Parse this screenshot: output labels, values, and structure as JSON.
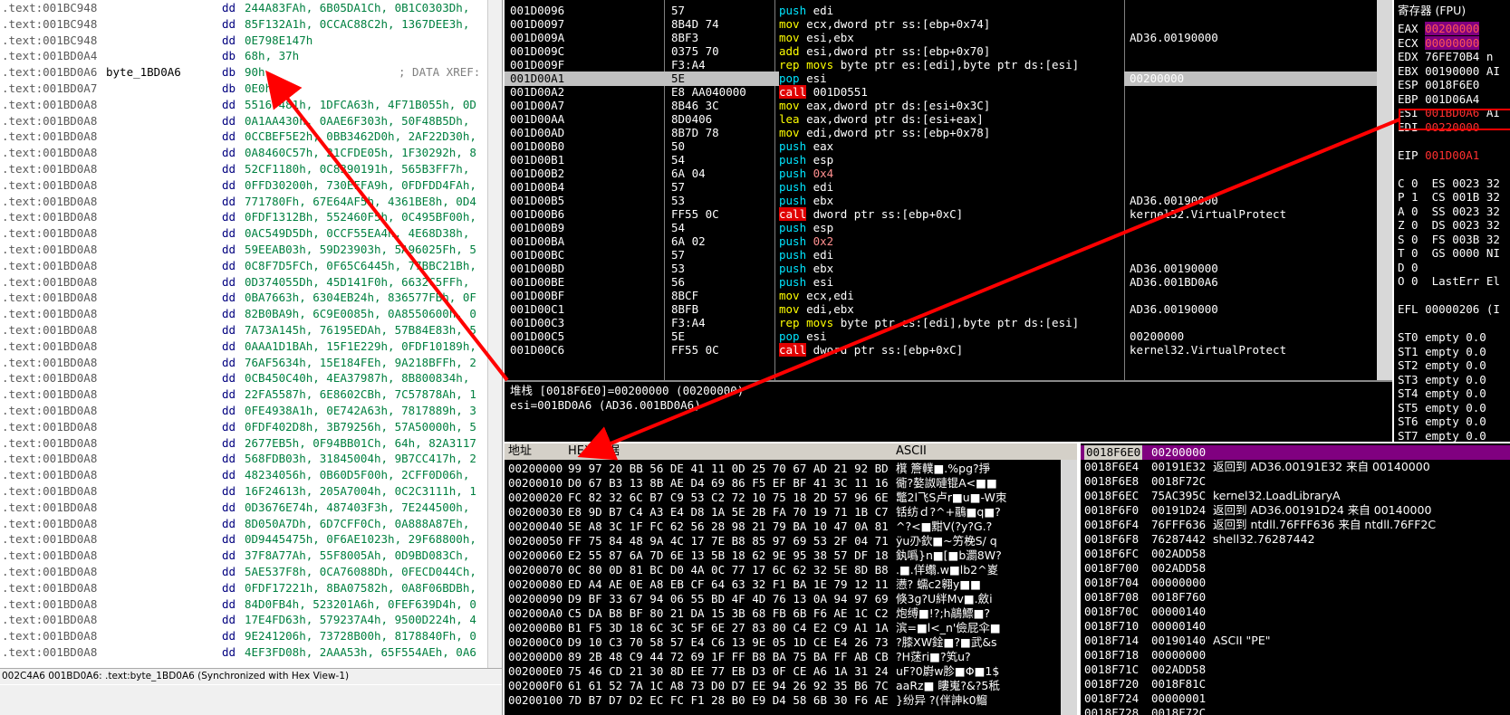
{
  "ida": {
    "lines": [
      {
        "addr": ".text:001BC948",
        "name": "",
        "op": "dd",
        "val": "244A83FAh, 6B05DA1Ch, 0B1C0303Dh,",
        "cmt": ""
      },
      {
        "addr": ".text:001BC948",
        "name": "",
        "op": "dd",
        "val": "85F132A1h, 0CCAC88C2h, 1367DEE3h,",
        "cmt": ""
      },
      {
        "addr": ".text:001BC948",
        "name": "",
        "op": "dd",
        "val": "0E798E147h",
        "cmt": ""
      },
      {
        "addr": ".text:001BD0A4",
        "name": "",
        "op": "db",
        "val": "68h, 37h",
        "cmt": ""
      },
      {
        "addr": ".text:001BD0A6",
        "name": "byte_1BD0A6",
        "op": "db",
        "val": "90h",
        "cmt": "; DATA XREF:"
      },
      {
        "addr": ".text:001BD0A7",
        "name": "",
        "op": "db",
        "val": "0E0h",
        "cmt": ""
      },
      {
        "addr": ".text:001BD0A8",
        "name": "",
        "op": "dd",
        "val": "55167481h, 1DFCA63h, 4F71B055h, 0D",
        "cmt": ""
      },
      {
        "addr": ".text:001BD0A8",
        "name": "",
        "op": "dd",
        "val": "0A1AA430h, 0AAE6F303h, 50F48B5Dh,",
        "cmt": ""
      },
      {
        "addr": ".text:001BD0A8",
        "name": "",
        "op": "dd",
        "val": "0CCBEF5E2h, 0BB3462D0h, 2AF22D30h,",
        "cmt": ""
      },
      {
        "addr": ".text:001BD0A8",
        "name": "",
        "op": "dd",
        "val": "0A8460C57h, 21CFDE05h, 1F30292h, 8",
        "cmt": ""
      },
      {
        "addr": ".text:001BD0A8",
        "name": "",
        "op": "dd",
        "val": "52CF1180h, 0C8390191h, 565B3FF7h,",
        "cmt": ""
      },
      {
        "addr": ".text:001BD0A8",
        "name": "",
        "op": "dd",
        "val": "0FFD30200h, 730EFFA9h, 0FDFDD4FAh,",
        "cmt": ""
      },
      {
        "addr": ".text:001BD0A8",
        "name": "",
        "op": "dd",
        "val": "771780Fh, 67E64AF5h, 4361BE8h, 0D4",
        "cmt": ""
      },
      {
        "addr": ".text:001BD0A8",
        "name": "",
        "op": "dd",
        "val": "0FDF1312Bh, 552460F5h, 0C495BF00h,",
        "cmt": ""
      },
      {
        "addr": ".text:001BD0A8",
        "name": "",
        "op": "dd",
        "val": "0AC549D5Dh, 0CCF55EA4h, 4E68D38h,",
        "cmt": ""
      },
      {
        "addr": ".text:001BD0A8",
        "name": "",
        "op": "dd",
        "val": "59EEAB03h, 59D23903h, 5A96025Fh, 5",
        "cmt": ""
      },
      {
        "addr": ".text:001BD0A8",
        "name": "",
        "op": "dd",
        "val": "0C8F7D5FCh, 0F65C6445h, 77BBC21Bh,",
        "cmt": ""
      },
      {
        "addr": ".text:001BD0A8",
        "name": "",
        "op": "dd",
        "val": "0D374055Dh, 45D141F0h, 6632C5FFh,",
        "cmt": ""
      },
      {
        "addr": ".text:001BD0A8",
        "name": "",
        "op": "dd",
        "val": "0BA7663h, 6304EB24h, 836577FBh, 0F",
        "cmt": ""
      },
      {
        "addr": ".text:001BD0A8",
        "name": "",
        "op": "dd",
        "val": "82B0BA9h, 6C9E0085h, 0A8550600h, 0",
        "cmt": ""
      },
      {
        "addr": ".text:001BD0A8",
        "name": "",
        "op": "dd",
        "val": "7A73A145h, 76195EDAh, 57B84E83h, 5",
        "cmt": ""
      },
      {
        "addr": ".text:001BD0A8",
        "name": "",
        "op": "dd",
        "val": "0AAA1D1BAh, 15F1E229h, 0FDF10189h,",
        "cmt": ""
      },
      {
        "addr": ".text:001BD0A8",
        "name": "",
        "op": "dd",
        "val": "76AF5634h, 15E184FEh, 9A218BFFh, 2",
        "cmt": ""
      },
      {
        "addr": ".text:001BD0A8",
        "name": "",
        "op": "dd",
        "val": "0CB450C40h, 4EA37987h, 8B800834h,",
        "cmt": ""
      },
      {
        "addr": ".text:001BD0A8",
        "name": "",
        "op": "dd",
        "val": "22FA5587h, 6E8602CBh, 7C57878Ah, 1",
        "cmt": ""
      },
      {
        "addr": ".text:001BD0A8",
        "name": "",
        "op": "dd",
        "val": "0FE4938A1h, 0E742A63h, 7817889h, 3",
        "cmt": ""
      },
      {
        "addr": ".text:001BD0A8",
        "name": "",
        "op": "dd",
        "val": "0FDF402D8h, 3B79256h, 57A50000h, 5",
        "cmt": ""
      },
      {
        "addr": ".text:001BD0A8",
        "name": "",
        "op": "dd",
        "val": "2677EB5h, 0F94BB01Ch, 64h, 82A3117",
        "cmt": ""
      },
      {
        "addr": ".text:001BD0A8",
        "name": "",
        "op": "dd",
        "val": "568FDB03h, 31845004h, 9B7CC417h, 2",
        "cmt": ""
      },
      {
        "addr": ".text:001BD0A8",
        "name": "",
        "op": "dd",
        "val": "48234056h, 0B60D5F00h, 2CFF0D06h,",
        "cmt": ""
      },
      {
        "addr": ".text:001BD0A8",
        "name": "",
        "op": "dd",
        "val": "16F24613h, 205A7004h, 0C2C3111h, 1",
        "cmt": ""
      },
      {
        "addr": ".text:001BD0A8",
        "name": "",
        "op": "dd",
        "val": "0D3676E74h, 487403F3h, 7E244500h,",
        "cmt": ""
      },
      {
        "addr": ".text:001BD0A8",
        "name": "",
        "op": "dd",
        "val": "8D050A7Dh, 6D7CFF0Ch, 0A888A87Eh,",
        "cmt": ""
      },
      {
        "addr": ".text:001BD0A8",
        "name": "",
        "op": "dd",
        "val": "0D9445475h, 0F6AE1023h, 29F68800h,",
        "cmt": ""
      },
      {
        "addr": ".text:001BD0A8",
        "name": "",
        "op": "dd",
        "val": "37F8A77Ah, 55F8005Ah, 0D9BD083Ch,",
        "cmt": ""
      },
      {
        "addr": ".text:001BD0A8",
        "name": "",
        "op": "dd",
        "val": "5AE537F8h, 0CA76088Dh, 0FECD044Ch,",
        "cmt": ""
      },
      {
        "addr": ".text:001BD0A8",
        "name": "",
        "op": "dd",
        "val": "0FDF17221h, 8BA07582h, 0A8F06BDBh,",
        "cmt": ""
      },
      {
        "addr": ".text:001BD0A8",
        "name": "",
        "op": "dd",
        "val": "84D0FB4h, 523201A6h, 0FEF639D4h, 0",
        "cmt": ""
      },
      {
        "addr": ".text:001BD0A8",
        "name": "",
        "op": "dd",
        "val": "17E4FD63h, 579237A4h, 9500D224h, 4",
        "cmt": ""
      },
      {
        "addr": ".text:001BD0A8",
        "name": "",
        "op": "dd",
        "val": "9E241206h, 73728B00h, 8178840Fh, 0",
        "cmt": ""
      },
      {
        "addr": ".text:001BD0A8",
        "name": "",
        "op": "dd",
        "val": "4EF3FD08h, 2AAA53h, 65F554AEh, 0A6",
        "cmt": ""
      }
    ],
    "status": "002C4A6 001BD0A6: .text:byte_1BD0A6 (Synchronized with Hex View-1)"
  },
  "cpu": {
    "rows": [
      {
        "addr": "001D0096",
        "hex": "57",
        "asm": [
          [
            "push",
            "push"
          ],
          [
            " edi",
            ""
          ]
        ],
        "cmt": ""
      },
      {
        "addr": "001D0097",
        "hex": "8B4D 74",
        "asm": [
          [
            "mov",
            "mov"
          ],
          [
            " ecx,dword ptr ss:[ebp+0x74]",
            ""
          ]
        ],
        "cmt": ""
      },
      {
        "addr": "001D009A",
        "hex": "8BF3",
        "asm": [
          [
            "mov",
            "mov"
          ],
          [
            " esi,ebx",
            ""
          ]
        ],
        "cmt": "AD36.00190000"
      },
      {
        "addr": "001D009C",
        "hex": "0375 70",
        "asm": [
          [
            "add",
            "mov"
          ],
          [
            " esi,dword ptr ss:[ebp+0x70]",
            ""
          ]
        ],
        "cmt": ""
      },
      {
        "addr": "001D009F",
        "hex": "F3:A4",
        "asm": [
          [
            "rep movs",
            "mov"
          ],
          [
            " byte ptr es:[edi],byte ptr ds:[esi]",
            ""
          ]
        ],
        "cmt": ""
      },
      {
        "addr": "001D00A1",
        "hex": "5E",
        "asm": [
          [
            "pop",
            "pop"
          ],
          [
            " esi",
            ""
          ]
        ],
        "cmt": "00200000",
        "sel": true
      },
      {
        "addr": "001D00A2",
        "hex": "E8 AA040000",
        "asm": [
          [
            "call",
            "call"
          ],
          [
            " 001D0551",
            ""
          ]
        ],
        "cmt": ""
      },
      {
        "addr": "001D00A7",
        "hex": "8B46 3C",
        "asm": [
          [
            "mov",
            "mov"
          ],
          [
            " eax,dword ptr ds:[esi+0x3C]",
            ""
          ]
        ],
        "cmt": ""
      },
      {
        "addr": "001D00AA",
        "hex": "8D0406",
        "asm": [
          [
            "lea",
            "mov"
          ],
          [
            " eax,dword ptr ds:[esi+eax]",
            ""
          ]
        ],
        "cmt": ""
      },
      {
        "addr": "001D00AD",
        "hex": "8B7D 78",
        "asm": [
          [
            "mov",
            "mov"
          ],
          [
            " edi,dword ptr ss:[ebp+0x78]",
            ""
          ]
        ],
        "cmt": ""
      },
      {
        "addr": "001D00B0",
        "hex": "50",
        "asm": [
          [
            "push",
            "push"
          ],
          [
            " eax",
            ""
          ]
        ],
        "cmt": ""
      },
      {
        "addr": "001D00B1",
        "hex": "54",
        "asm": [
          [
            "push",
            "push"
          ],
          [
            " esp",
            ""
          ]
        ],
        "cmt": ""
      },
      {
        "addr": "001D00B2",
        "hex": "6A 04",
        "asm": [
          [
            "push",
            "push"
          ],
          [
            " 0x4",
            "num"
          ]
        ],
        "cmt": ""
      },
      {
        "addr": "001D00B4",
        "hex": "57",
        "asm": [
          [
            "push",
            "push"
          ],
          [
            " edi",
            ""
          ]
        ],
        "cmt": ""
      },
      {
        "addr": "001D00B5",
        "hex": "53",
        "asm": [
          [
            "push",
            "push"
          ],
          [
            " ebx",
            ""
          ]
        ],
        "cmt": "AD36.00190000"
      },
      {
        "addr": "001D00B6",
        "hex": "FF55 0C",
        "asm": [
          [
            "call",
            "call"
          ],
          [
            " dword ptr ss:[ebp+0xC]",
            ""
          ]
        ],
        "cmt": "kernel32.VirtualProtect"
      },
      {
        "addr": "001D00B9",
        "hex": "54",
        "asm": [
          [
            "push",
            "push"
          ],
          [
            " esp",
            ""
          ]
        ],
        "cmt": ""
      },
      {
        "addr": "001D00BA",
        "hex": "6A 02",
        "asm": [
          [
            "push",
            "push"
          ],
          [
            " 0x2",
            "num"
          ]
        ],
        "cmt": ""
      },
      {
        "addr": "001D00BC",
        "hex": "57",
        "asm": [
          [
            "push",
            "push"
          ],
          [
            " edi",
            ""
          ]
        ],
        "cmt": ""
      },
      {
        "addr": "001D00BD",
        "hex": "53",
        "asm": [
          [
            "push",
            "push"
          ],
          [
            " ebx",
            ""
          ]
        ],
        "cmt": "AD36.00190000"
      },
      {
        "addr": "001D00BE",
        "hex": "56",
        "asm": [
          [
            "push",
            "push"
          ],
          [
            " esi",
            ""
          ]
        ],
        "cmt": "AD36.001BD0A6"
      },
      {
        "addr": "001D00BF",
        "hex": "8BCF",
        "asm": [
          [
            "mov",
            "mov"
          ],
          [
            " ecx,edi",
            ""
          ]
        ],
        "cmt": ""
      },
      {
        "addr": "001D00C1",
        "hex": "8BFB",
        "asm": [
          [
            "mov",
            "mov"
          ],
          [
            " edi,ebx",
            ""
          ]
        ],
        "cmt": "AD36.00190000"
      },
      {
        "addr": "001D00C3",
        "hex": "F3:A4",
        "asm": [
          [
            "rep movs",
            "mov"
          ],
          [
            " byte ptr es:[edi],byte ptr ds:[esi]",
            ""
          ]
        ],
        "cmt": ""
      },
      {
        "addr": "001D00C5",
        "hex": "5E",
        "asm": [
          [
            "pop",
            "pop"
          ],
          [
            " esi",
            ""
          ]
        ],
        "cmt": "00200000"
      },
      {
        "addr": "001D00C6",
        "hex": "FF55 0C",
        "asm": [
          [
            "call",
            "call"
          ],
          [
            " dword ptr ss:[ebp+0xC]",
            ""
          ]
        ],
        "cmt": "kernel32.VirtualProtect"
      }
    ],
    "info1": "堆栈 [0018F6E0]=00200000 (00200000)",
    "info2": "esi=001BD0A6 (AD36.001BD0A6)"
  },
  "regs": {
    "title": "寄存器 (FPU)",
    "rows": [
      {
        "t": "EAX 00200000",
        "hl": "EAX"
      },
      {
        "t": "ECX 00000000",
        "hl": "ECX"
      },
      {
        "t": "EDX 76FE70B4 n"
      },
      {
        "t": "EBX 00190000 AI"
      },
      {
        "t": "ESP 0018F6E0"
      },
      {
        "t": "EBP 001D06A4"
      },
      {
        "t": "ESI 001BD0A6 AI",
        "hl": "ESI"
      },
      {
        "t": "EDI 00220000",
        "hl": "EDI"
      },
      {
        "t": ""
      },
      {
        "t": "EIP 001D00A1",
        "hl": "EIP"
      },
      {
        "t": ""
      },
      {
        "t": "C 0  ES 0023 32"
      },
      {
        "t": "P 1  CS 001B 32"
      },
      {
        "t": "A 0  SS 0023 32"
      },
      {
        "t": "Z 0  DS 0023 32"
      },
      {
        "t": "S 0  FS 003B 32"
      },
      {
        "t": "T 0  GS 0000 NI"
      },
      {
        "t": "D 0"
      },
      {
        "t": "O 0  LastErr El"
      },
      {
        "t": ""
      },
      {
        "t": "EFL 00000206 (I"
      },
      {
        "t": ""
      },
      {
        "t": "ST0 empty 0.0"
      },
      {
        "t": "ST1 empty 0.0"
      },
      {
        "t": "ST2 empty 0.0"
      },
      {
        "t": "ST3 empty 0.0"
      },
      {
        "t": "ST4 empty 0.0"
      },
      {
        "t": "ST5 empty 0.0"
      },
      {
        "t": "ST6 empty 0.0"
      },
      {
        "t": "ST7 empty 0.0"
      }
    ]
  },
  "dump": {
    "head_addr": "地址",
    "head_hex": "HEX 数据",
    "head_ascii": "ASCII",
    "rows": [
      {
        "a": "00200000",
        "h": "99 97 20 BB 56 DE 41 11 0D 25 70 67 AD 21 92 BD",
        "s": "檱 簷轐■.%pg?掙"
      },
      {
        "a": "00200010",
        "h": "D0 67 B3 13 8B AE D4 69 86 F5 EF BF 41 3C 11 16",
        "s": "衚?嫯詉嗹锟A<■■"
      },
      {
        "a": "00200020",
        "h": "FC 82 32 6C B7 C9 53 C2 72 10 75 18 2D 57 96 6E",
        "s": "鼈2l飞S卢r■u■-W朿"
      },
      {
        "a": "00200030",
        "h": "E8 9D B7 C4 A3 E4 D8 1A 5E 2B FA 70 19 71 1B C7",
        "s": "铦纺ｄ?^+鷊■q■?"
      },
      {
        "a": "00200040",
        "h": "5E A8 3C 1F FC 62 56 28 98 21 79 BA 10 47 0A 81",
        "s": "^?<■黚V(?y?G.?"
      },
      {
        "a": "00200050",
        "h": "FF 75 84 48 9A 4C 17 7E B8 85 97 69 53 2F 04 71",
        "s": "ÿu刅欽■~竻梚S/ q"
      },
      {
        "a": "00200060",
        "h": "E2 55 87 6A 7D 6E 13 5B 18 62 9E 95 38 57 DF 18",
        "s": "釻噅}n■[■b瀱8W?"
      },
      {
        "a": "00200070",
        "h": "0C 80 0D 81 BC D0 4A 0C 77 17 6C 62 32 5E 8D B8",
        "s": ".■.佯蠮.w■lb2^嵏"
      },
      {
        "a": "00200080",
        "h": "ED A4 AE 0E A8 EB CF 64 63 32 F1 BA 1E 79 12 11",
        "s": "懑? 蠕c2翱y■■"
      },
      {
        "a": "00200090",
        "h": "D9 BF 33 67 94 06 55 BD 4F 4D 76 13 0A 94 97 69",
        "s": "倏3g?U絆Mv■.斂i"
      },
      {
        "a": "002000A0",
        "h": "C5 DA B8 BF 80 21 DA 15 3B 68 FB 6B F6 AE 1C C2",
        "s": "炮缚■!?;h鶮鰾■?"
      },
      {
        "a": "002000B0",
        "h": "B1 F5 3D 18 6C 3C 5F 6E 27 83 80 C4 E2 C9 A1 1A",
        "s": "滨=■l<_n'儉屁伞■"
      },
      {
        "a": "002000C0",
        "h": "D9 10 C3 70 58 57 E4 C6 13 9E 05 1D CE E4 26 73",
        "s": "?膝XW鍂■?■武&s"
      },
      {
        "a": "002000D0",
        "h": "89 2B 48 C9 44 72 69 1F FF B8 BA 75 BA FF AB CB",
        "s": "?H蒁ri■?笂u?"
      },
      {
        "a": "002000E0",
        "h": "75 46 CD 21 30 8D EE 77 EB D3 0F CE A6 1A 31 24",
        "s": "uF?0嶎w胗■Φ■1$"
      },
      {
        "a": "002000F0",
        "h": "61 61 52 7A 1C A8 73 D0 D7 EE 94 26 92 35 B6 7C",
        "s": "aaRz■ 瞜嵬?&?5秪"
      },
      {
        "a": "00200100",
        "h": "7D B7 D7 D2 EC FC F1 28 B0 E9 D4 58 6B 30 F6 AE",
        "s": "}纷异 ?(伴訷k0鰡"
      }
    ]
  },
  "stack": {
    "rows": [
      {
        "a": "0018F6E0",
        "v": "00200000",
        "c": "",
        "sel": true
      },
      {
        "a": "0018F6E4",
        "v": "00191E32",
        "c": "返回到 AD36.00191E32 来自 00140000"
      },
      {
        "a": "0018F6E8",
        "v": "0018F72C",
        "c": ""
      },
      {
        "a": "0018F6EC",
        "v": "75AC395C",
        "c": "kernel32.LoadLibraryA"
      },
      {
        "a": "0018F6F0",
        "v": "00191D24",
        "c": "返回到 AD36.00191D24 来自 00140000"
      },
      {
        "a": "0018F6F4",
        "v": "76FFF636",
        "c": "返回到 ntdll.76FFF636 来自 ntdll.76FF2C"
      },
      {
        "a": "0018F6F8",
        "v": "76287442",
        "c": "shell32.76287442"
      },
      {
        "a": "0018F6FC",
        "v": "002ADD58",
        "c": ""
      },
      {
        "a": "0018F700",
        "v": "002ADD58",
        "c": ""
      },
      {
        "a": "0018F704",
        "v": "00000000",
        "c": ""
      },
      {
        "a": "0018F708",
        "v": "0018F760",
        "c": ""
      },
      {
        "a": "0018F70C",
        "v": "00000140",
        "c": ""
      },
      {
        "a": "0018F710",
        "v": "00000140",
        "c": ""
      },
      {
        "a": "0018F714",
        "v": "00190140",
        "c": "ASCII \"PE\""
      },
      {
        "a": "0018F718",
        "v": "00000000",
        "c": ""
      },
      {
        "a": "0018F71C",
        "v": "002ADD58",
        "c": ""
      },
      {
        "a": "0018F720",
        "v": "0018F81C",
        "c": ""
      },
      {
        "a": "0018F724",
        "v": "00000001",
        "c": ""
      },
      {
        "a": "0018F728",
        "v": "0018F72C",
        "c": ""
      }
    ]
  }
}
